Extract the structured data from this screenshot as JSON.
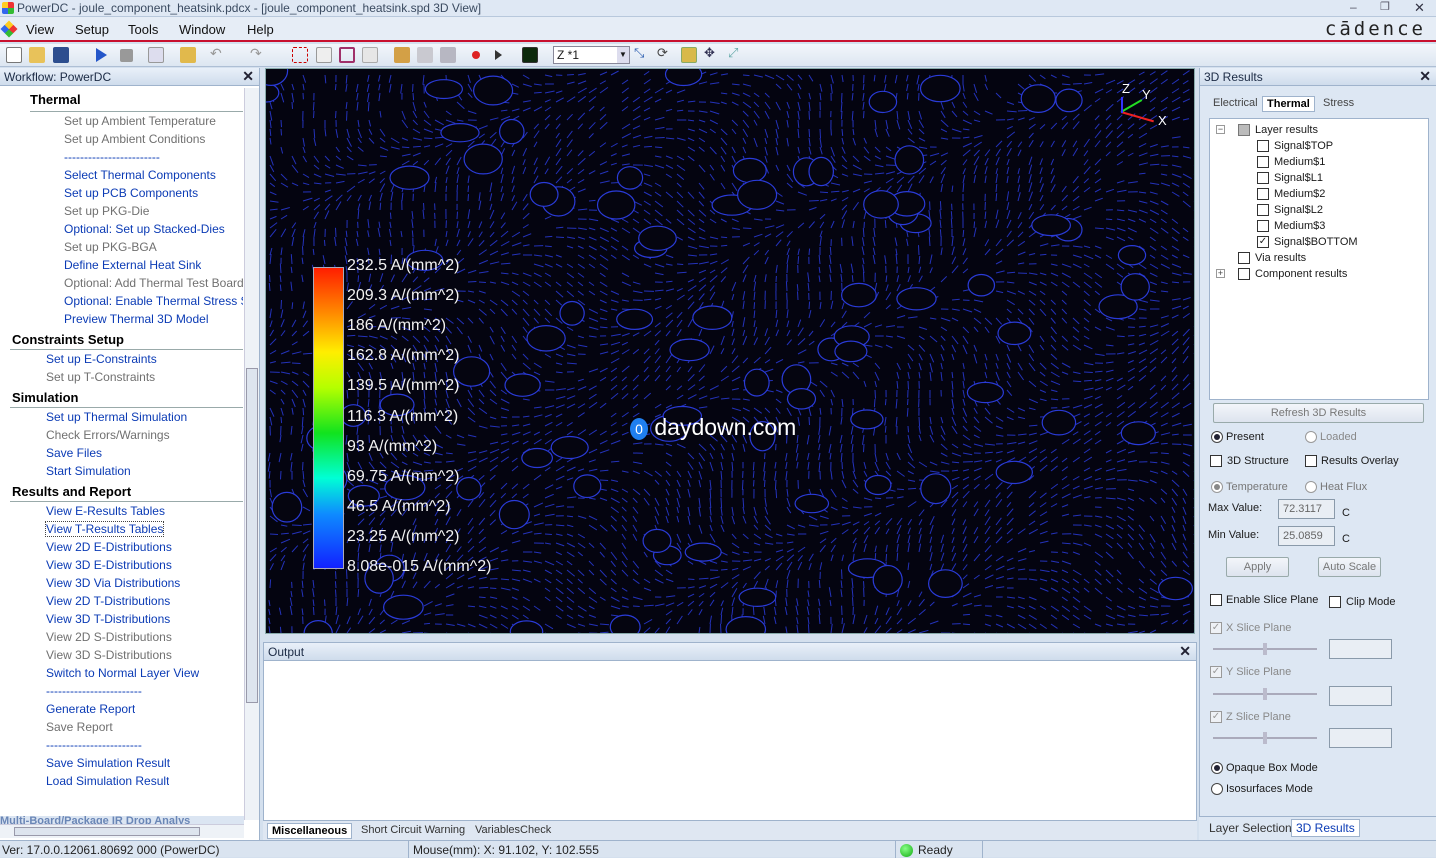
{
  "window": {
    "title": "PowerDC - joule_component_heatsink.pdcx - [joule_component_heatsink.spd 3D View]",
    "brand": "cādence"
  },
  "menu": [
    "View",
    "Setup",
    "Tools",
    "Window",
    "Help"
  ],
  "toolbar": {
    "zoom_value": "Z *1"
  },
  "workflow": {
    "title": "Workflow: PowerDC",
    "items": [
      {
        "text": "Thermal",
        "kind": "section"
      },
      {
        "text": "Set up Ambient Temperature",
        "kind": "disabled"
      },
      {
        "text": "Set up Ambient Conditions",
        "kind": "disabled"
      },
      {
        "text": "------------------------",
        "kind": "dash"
      },
      {
        "text": "Select Thermal Components",
        "kind": "link"
      },
      {
        "text": "Set up PCB Components",
        "kind": "link"
      },
      {
        "text": "Set up PKG-Die",
        "kind": "disabled"
      },
      {
        "text": "Optional: Set up Stacked-Dies",
        "kind": "link"
      },
      {
        "text": "Set up PKG-BGA",
        "kind": "disabled"
      },
      {
        "text": "Define External Heat Sink",
        "kind": "link"
      },
      {
        "text": "Optional: Add Thermal Test Board",
        "kind": "disabled"
      },
      {
        "text": "Optional: Enable Thermal Stress Si",
        "kind": "link"
      },
      {
        "text": "Preview Thermal 3D Model",
        "kind": "link"
      },
      {
        "text": "Constraints Setup",
        "kind": "section"
      },
      {
        "text": "Set up E-Constraints",
        "kind": "link"
      },
      {
        "text": "Set up T-Constraints",
        "kind": "disabled"
      },
      {
        "text": "Simulation",
        "kind": "section"
      },
      {
        "text": "Set up Thermal Simulation",
        "kind": "link"
      },
      {
        "text": "Check Errors/Warnings",
        "kind": "disabled"
      },
      {
        "text": "Save Files",
        "kind": "link"
      },
      {
        "text": "Start Simulation",
        "kind": "link"
      },
      {
        "text": "Results and Report",
        "kind": "section"
      },
      {
        "text": "View E-Results Tables",
        "kind": "link"
      },
      {
        "text": "View T-Results Tables",
        "kind": "link-selected"
      },
      {
        "text": "View 2D E-Distributions",
        "kind": "link"
      },
      {
        "text": "View 3D E-Distributions",
        "kind": "link"
      },
      {
        "text": "View 3D Via Distributions",
        "kind": "link"
      },
      {
        "text": "View 2D T-Distributions",
        "kind": "link"
      },
      {
        "text": "View 3D T-Distributions",
        "kind": "link"
      },
      {
        "text": "View 2D S-Distributions",
        "kind": "disabled"
      },
      {
        "text": "View 3D S-Distributions",
        "kind": "disabled"
      },
      {
        "text": "Switch to Normal Layer View",
        "kind": "link"
      },
      {
        "text": "------------------------",
        "kind": "dash"
      },
      {
        "text": "Generate Report",
        "kind": "link"
      },
      {
        "text": "Save Report",
        "kind": "disabled"
      },
      {
        "text": "------------------------",
        "kind": "dash"
      },
      {
        "text": "Save Simulation Result",
        "kind": "link"
      },
      {
        "text": "Load Simulation Result",
        "kind": "link"
      }
    ],
    "footer_tab": "Multi-Board/Package IR Drop Analys"
  },
  "view3d": {
    "legend": [
      "232.5 A/(mm^2)",
      "209.3 A/(mm^2)",
      "186 A/(mm^2)",
      "162.8 A/(mm^2)",
      "139.5 A/(mm^2)",
      "116.3 A/(mm^2)",
      "93 A/(mm^2)",
      "69.75 A/(mm^2)",
      "46.5 A/(mm^2)",
      "23.25 A/(mm^2)",
      "8.08e-015 A/(mm^2)"
    ],
    "axes": {
      "z": "Z",
      "y": "Y",
      "x": "X"
    },
    "watermark": "daydown.com",
    "field_color": "#2a3bd8"
  },
  "output": {
    "title": "Output",
    "tabs": [
      "Miscellaneous",
      "Short Circuit Warning",
      "VariablesCheck"
    ]
  },
  "results": {
    "title": "3D Results",
    "tabs": [
      "Electrical",
      "Thermal",
      "Stress"
    ],
    "tree": [
      {
        "label": "Layer results",
        "checked": "partial",
        "level": 0,
        "expand": "−"
      },
      {
        "label": "Signal$TOP",
        "checked": false,
        "level": 1
      },
      {
        "label": "Medium$1",
        "checked": false,
        "level": 1
      },
      {
        "label": "Signal$L1",
        "checked": false,
        "level": 1
      },
      {
        "label": "Medium$2",
        "checked": false,
        "level": 1
      },
      {
        "label": "Signal$L2",
        "checked": false,
        "level": 1
      },
      {
        "label": "Medium$3",
        "checked": false,
        "level": 1
      },
      {
        "label": "Signal$BOTTOM",
        "checked": true,
        "level": 1
      },
      {
        "label": "Via results",
        "checked": false,
        "level": 0
      },
      {
        "label": "Component results",
        "checked": false,
        "level": 0,
        "expand": "+"
      }
    ],
    "refresh_label": "Refresh 3D Results",
    "present": "Present",
    "loaded": "Loaded",
    "structure": "3D Structure",
    "overlay": "Results Overlay",
    "temperature": "Temperature",
    "heat_flux": "Heat Flux",
    "max_label": "Max Value:",
    "max_value": "72.3117",
    "max_unit": "C",
    "min_label": "Min Value:",
    "min_value": "25.0859",
    "min_unit": "C",
    "apply": "Apply",
    "auto_scale": "Auto Scale",
    "enable_slice": "Enable Slice Plane",
    "clip_mode": "Clip Mode",
    "x_slice": "X Slice Plane",
    "y_slice": "Y Slice Plane",
    "z_slice": "Z Slice Plane",
    "opaque": "Opaque Box Mode",
    "iso": "Isosurfaces Mode",
    "bottom_tabs": [
      "Layer Selection",
      "3D Results"
    ]
  },
  "status": {
    "version": "Ver: 17.0.0.12061.80692  000 (PowerDC)",
    "mouse": "Mouse(mm): X: 91.102, Y: 102.555",
    "ready": "Ready"
  }
}
